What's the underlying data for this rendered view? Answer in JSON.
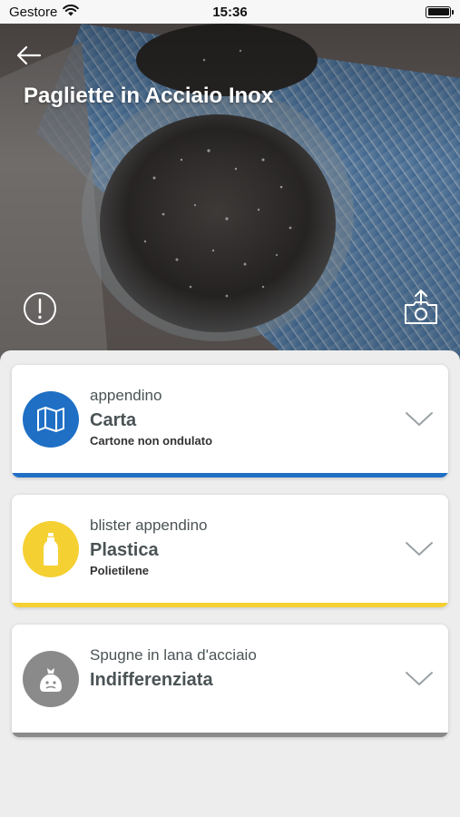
{
  "status": {
    "carrier": "Gestore",
    "time": "15:36"
  },
  "header": {
    "title": "Pagliette in Acciaio Inox"
  },
  "cards": [
    {
      "label": "appendino",
      "type": "Carta",
      "detail": "Cartone non ondulato",
      "color": "#1f6fc5",
      "icon": "map-icon"
    },
    {
      "label": "blister appendino",
      "type": "Plastica",
      "detail": "Polietilene",
      "color": "#f5d033",
      "icon": "bottle-icon"
    },
    {
      "label": "Spugne in lana d'acciaio",
      "type": "Indifferenziata",
      "detail": "",
      "color": "#8a8a8a",
      "icon": "trash-bag-icon"
    }
  ]
}
